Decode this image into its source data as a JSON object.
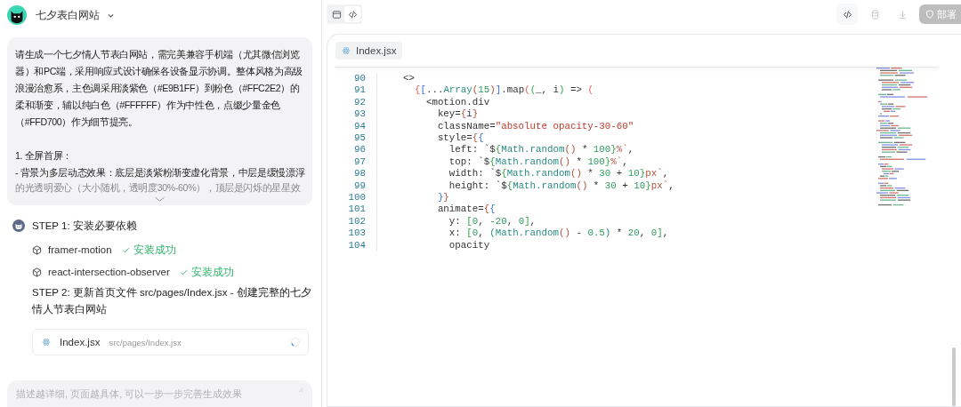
{
  "app": {
    "title": "七夕表白网站"
  },
  "prompt": {
    "paragraphs": [
      {
        "text": "请生成一个七夕情人节表白网站，需完美兼容手机端（尤其微信浏览器）和PC端，采用响应式设计确保各设备显示协调。整体风格为高级浪漫治愈系，主色调采用淡紫色（#E9B1FF）到粉色（#FFC2E2）的柔和渐变，辅以纯白色（#FFFFFF）作为中性色，点缀少量金色（#FFD700）作为细节提亮。",
        "faded": false
      },
      {
        "text": "1. 全屏首屏：",
        "faded": false
      },
      {
        "text": "- 背景为多层动态效果：底层是淡紫粉渐变虚化背景，中层是缓慢漂浮",
        "faded": false
      },
      {
        "text": "的光透明爱心（大小随机，透明度30%-60%），顶层是闪烁的星星效",
        "faded": true
      }
    ],
    "collapsed": true
  },
  "steps": [
    {
      "kind": "heading",
      "text": "STEP 1: 安装必要依赖"
    },
    {
      "kind": "package",
      "name": "framer-motion",
      "status": "安装成功",
      "done": true
    },
    {
      "kind": "package",
      "name": "react-intersection-observer",
      "status": "安装成功",
      "done": true
    },
    {
      "kind": "heading",
      "text": "STEP 2: 更新首页文件 src/pages/Index.jsx - 创建完整的七夕情人节表白网站"
    },
    {
      "kind": "file",
      "name": "Index.jsx",
      "path": "src/pages/Index.jsx",
      "loading": true
    }
  ],
  "input": {
    "placeholder": "描述越详细, 页面越具体, 可以一步一步完善生成效果"
  },
  "view_toggle": [
    {
      "kind": "preview",
      "selected": false
    },
    {
      "kind": "code",
      "selected": true
    }
  ],
  "actions": [
    {
      "kind": "code",
      "disabled": false
    },
    {
      "kind": "database",
      "disabled": true
    },
    {
      "kind": "download",
      "disabled": true
    },
    {
      "kind": "deploy",
      "label": "部署",
      "disabled": true
    }
  ],
  "editor": {
    "tabs": [
      {
        "label": "Index.jsx",
        "selected": true
      }
    ],
    "lines": [
      {
        "number": "90",
        "tokens": [
          {
            "kind": "plain",
            "text": "<>"
          }
        ]
      },
      {
        "number": "91",
        "tokens": [
          {
            "kind": "brace",
            "text": "  {"
          },
          {
            "kind": "bracket",
            "text": "["
          },
          {
            "kind": "plain",
            "text": "..."
          },
          {
            "kind": "call",
            "text": "Array"
          },
          {
            "kind": "paren",
            "text": "("
          },
          {
            "kind": "number",
            "text": "15"
          },
          {
            "kind": "paren",
            "text": ")"
          },
          {
            "kind": "bracket",
            "text": "]"
          },
          {
            "kind": "plain",
            "text": ".map"
          },
          {
            "kind": "brace",
            "text": "("
          },
          {
            "kind": "group",
            "text": "("
          },
          {
            "kind": "plain",
            "text": "_, i"
          },
          {
            "kind": "group",
            "text": ")"
          },
          {
            "kind": "plain",
            "text": " => "
          },
          {
            "kind": "brace",
            "text": "("
          }
        ]
      },
      {
        "number": "92",
        "tokens": [
          {
            "kind": "plain",
            "text": "    <motion.div"
          }
        ]
      },
      {
        "number": "93",
        "tokens": [
          {
            "kind": "plain",
            "text": "      key="
          },
          {
            "kind": "paren",
            "text": "{"
          },
          {
            "kind": "plain",
            "text": "i"
          },
          {
            "kind": "paren",
            "text": "}"
          }
        ]
      },
      {
        "number": "94",
        "tokens": [
          {
            "kind": "plain",
            "text": "      className="
          },
          {
            "kind": "string",
            "text": "\"absolute opacity-30-60\""
          }
        ]
      },
      {
        "number": "95",
        "tokens": [
          {
            "kind": "plain",
            "text": "      style="
          },
          {
            "kind": "paren",
            "text": "{"
          },
          {
            "kind": "bracket",
            "text": "{"
          }
        ]
      },
      {
        "number": "96",
        "tokens": [
          {
            "kind": "plain",
            "text": "        left: `$"
          },
          {
            "kind": "group",
            "text": "{"
          },
          {
            "kind": "call",
            "text": "Math.random"
          },
          {
            "kind": "paren",
            "text": "()"
          },
          {
            "kind": "plain",
            "text": " * "
          },
          {
            "kind": "number",
            "text": "100"
          },
          {
            "kind": "group",
            "text": "}"
          },
          {
            "kind": "paren",
            "text": "%`"
          },
          {
            "kind": "plain",
            "text": ","
          }
        ]
      },
      {
        "number": "97",
        "tokens": [
          {
            "kind": "plain",
            "text": "        top: `$"
          },
          {
            "kind": "group",
            "text": "{"
          },
          {
            "kind": "call",
            "text": "Math.random"
          },
          {
            "kind": "paren",
            "text": "()"
          },
          {
            "kind": "plain",
            "text": " * "
          },
          {
            "kind": "number",
            "text": "100"
          },
          {
            "kind": "group",
            "text": "}"
          },
          {
            "kind": "paren",
            "text": "%`"
          },
          {
            "kind": "plain",
            "text": ","
          }
        ]
      },
      {
        "number": "98",
        "tokens": [
          {
            "kind": "plain",
            "text": "        width: `$"
          },
          {
            "kind": "group",
            "text": "{"
          },
          {
            "kind": "call",
            "text": "Math.random"
          },
          {
            "kind": "paren",
            "text": "()"
          },
          {
            "kind": "plain",
            "text": " * "
          },
          {
            "kind": "number",
            "text": "30"
          },
          {
            "kind": "plain",
            "text": " + "
          },
          {
            "kind": "number",
            "text": "10"
          },
          {
            "kind": "group",
            "text": "}"
          },
          {
            "kind": "paren",
            "text": "px`"
          },
          {
            "kind": "plain",
            "text": ","
          }
        ]
      },
      {
        "number": "99",
        "tokens": [
          {
            "kind": "plain",
            "text": "        height: `$"
          },
          {
            "kind": "group",
            "text": "{"
          },
          {
            "kind": "call",
            "text": "Math.random"
          },
          {
            "kind": "paren",
            "text": "()"
          },
          {
            "kind": "plain",
            "text": " * "
          },
          {
            "kind": "number",
            "text": "30"
          },
          {
            "kind": "plain",
            "text": " + "
          },
          {
            "kind": "number",
            "text": "10"
          },
          {
            "kind": "group",
            "text": "}"
          },
          {
            "kind": "paren",
            "text": "px`"
          },
          {
            "kind": "plain",
            "text": ","
          }
        ]
      },
      {
        "number": "100",
        "tokens": [
          {
            "kind": "bracket",
            "text": "      }"
          },
          {
            "kind": "paren",
            "text": "}"
          }
        ]
      },
      {
        "number": "101",
        "tokens": [
          {
            "kind": "plain",
            "text": "      animate="
          },
          {
            "kind": "paren",
            "text": "{"
          },
          {
            "kind": "bracket",
            "text": "{"
          }
        ]
      },
      {
        "number": "102",
        "tokens": [
          {
            "kind": "plain",
            "text": "        y: "
          },
          {
            "kind": "group",
            "text": "["
          },
          {
            "kind": "number",
            "text": "0"
          },
          {
            "kind": "plain",
            "text": ", "
          },
          {
            "kind": "number",
            "text": "-20"
          },
          {
            "kind": "plain",
            "text": ", "
          },
          {
            "kind": "number",
            "text": "0"
          },
          {
            "kind": "group",
            "text": "]"
          },
          {
            "kind": "plain",
            "text": ","
          }
        ]
      },
      {
        "number": "103",
        "tokens": [
          {
            "kind": "plain",
            "text": "        x: "
          },
          {
            "kind": "group",
            "text": "["
          },
          {
            "kind": "number",
            "text": "0"
          },
          {
            "kind": "plain",
            "text": ", "
          },
          {
            "kind": "call",
            "text": "(Math.random"
          },
          {
            "kind": "paren",
            "text": "()"
          },
          {
            "kind": "plain",
            "text": " - "
          },
          {
            "kind": "number",
            "text": "0.5"
          },
          {
            "kind": "call",
            "text": ")"
          },
          {
            "kind": "plain",
            "text": " * "
          },
          {
            "kind": "number",
            "text": "20"
          },
          {
            "kind": "plain",
            "text": ", "
          },
          {
            "kind": "number",
            "text": "0"
          },
          {
            "kind": "group",
            "text": "]"
          },
          {
            "kind": "plain",
            "text": ","
          }
        ]
      },
      {
        "number": "104",
        "tokens": [
          {
            "kind": "plain",
            "text": "        opacity"
          }
        ]
      }
    ]
  }
}
